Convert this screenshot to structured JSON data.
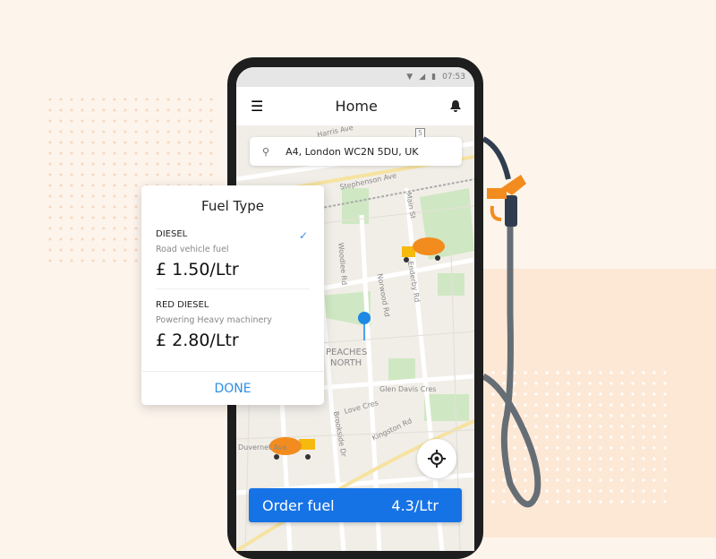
{
  "status": {
    "time": "07:53"
  },
  "header": {
    "title": "Home"
  },
  "search": {
    "value": "A4, London WC2N 5DU, UK"
  },
  "map_labels": [
    "Harris Ave",
    "Stephenson Ave",
    "Main St",
    "Woodlee Rd",
    "Norwood Rd",
    "Enderby Rd",
    "PEACHES",
    "NORTH",
    "Glen Davis Cres",
    "Love Cres",
    "Kingston Rd",
    "Brookside Dr",
    "Duvernet Ave",
    "5"
  ],
  "fuel_card": {
    "title": "Fuel Type",
    "options": [
      {
        "name": "DIESEL",
        "desc": "Road vehicle fuel",
        "price": "£  1.50/Ltr",
        "selected": true
      },
      {
        "name": "RED DIESEL",
        "desc": "Powering Heavy machinery",
        "price": "£ 2.80/Ltr"
      }
    ],
    "done": "DONE"
  },
  "order": {
    "label": "Order fuel",
    "price": "4.3/Ltr"
  },
  "colors": {
    "accent": "#1673e6",
    "nozzle": "#f28c1e"
  }
}
